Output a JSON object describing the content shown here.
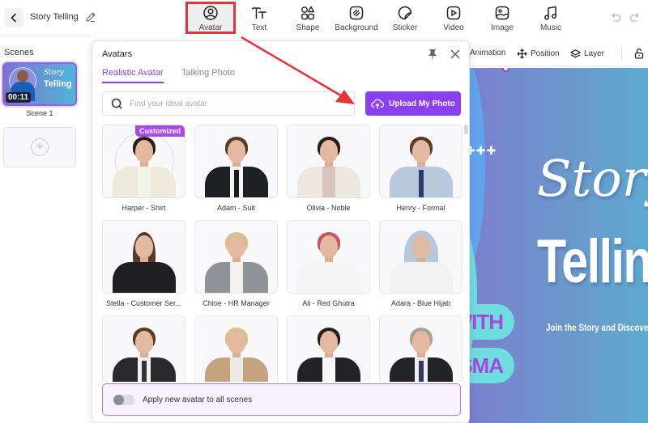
{
  "header": {
    "back_label": "Back",
    "project_title": "Story Telling",
    "tools": [
      {
        "id": "avatar",
        "label": "Avatar",
        "icon": "avatar-icon",
        "active": true
      },
      {
        "id": "text",
        "label": "Text",
        "icon": "text-icon",
        "active": false
      },
      {
        "id": "shape",
        "label": "Shape",
        "icon": "shape-icon",
        "active": false
      },
      {
        "id": "background",
        "label": "Background",
        "icon": "background-icon",
        "active": false
      },
      {
        "id": "sticker",
        "label": "Sticker",
        "icon": "sticker-icon",
        "active": false
      },
      {
        "id": "video",
        "label": "Video",
        "icon": "video-icon",
        "active": false
      },
      {
        "id": "image",
        "label": "Image",
        "icon": "image-icon",
        "active": false
      },
      {
        "id": "music",
        "label": "Music",
        "icon": "music-icon",
        "active": false
      }
    ],
    "highlight_color": "#e8333a"
  },
  "scenes": {
    "title": "Scenes",
    "items": [
      {
        "label": "Scene 1",
        "duration": "00:11",
        "thumb_title_1": "Story",
        "thumb_title_2": "Telling",
        "selected": true
      }
    ],
    "add_label": "+"
  },
  "canvas_toolbar": {
    "items": [
      {
        "label": "Animation",
        "icon": "animation-icon"
      },
      {
        "label": "Position",
        "icon": "move-icon"
      },
      {
        "label": "Layer",
        "icon": "layers-icon"
      }
    ],
    "lock_icon": "lock-open-icon"
  },
  "canvas": {
    "title_script": "Story",
    "title_bold": "Telling",
    "pill_1": "WITH",
    "pill_2": "SMA",
    "subtitle": "Join the Story and Discover",
    "dots": "✚✚✚"
  },
  "avatars_panel": {
    "title": "Avatars",
    "tabs": [
      {
        "label": "Realistic Avatar",
        "active": true
      },
      {
        "label": "Talking Photo",
        "active": false
      }
    ],
    "search_placeholder": "Find your ideal avatar",
    "search_value": "",
    "upload_label": "Upload My Photo",
    "accent_color": "#8a3ff0",
    "avatars": [
      {
        "name": "Harper - Shirt",
        "badge": "Customized",
        "outfit": "cream-shirt",
        "hair": "dark",
        "gender": "f"
      },
      {
        "name": "Adam - Suit",
        "badge": "",
        "outfit": "black-suit",
        "hair": "brown",
        "gender": "m"
      },
      {
        "name": "Olivia - Noble",
        "badge": "",
        "outfit": "cream-blazer",
        "hair": "dark",
        "gender": "f"
      },
      {
        "name": "Henry - Formal",
        "badge": "",
        "outfit": "blue-shirt",
        "hair": "brown",
        "gender": "m"
      },
      {
        "name": "Stella - Customer Ser...",
        "badge": "",
        "outfit": "black-shirt",
        "hair": "brown",
        "gender": "f"
      },
      {
        "name": "Chloe - HR Manager",
        "badge": "",
        "outfit": "grey-blazer",
        "hair": "blonde",
        "gender": "f"
      },
      {
        "name": "Ali - Red Ghutra",
        "badge": "",
        "outfit": "white-thobe",
        "hair": "ghutra",
        "gender": "m"
      },
      {
        "name": "Adara - Blue Hijab",
        "badge": "",
        "outfit": "blue-hijab",
        "hair": "hijab",
        "gender": "f"
      },
      {
        "name": "",
        "badge": "",
        "outfit": "vest",
        "hair": "brown",
        "gender": "m"
      },
      {
        "name": "",
        "badge": "",
        "outfit": "tan-blazer",
        "hair": "blonde",
        "gender": "f"
      },
      {
        "name": "",
        "badge": "",
        "outfit": "black-blazer",
        "hair": "dark",
        "gender": "f"
      },
      {
        "name": "",
        "badge": "",
        "outfit": "black-suit-old",
        "hair": "grey",
        "gender": "m"
      }
    ],
    "apply_all_label": "Apply new avatar to all scenes",
    "apply_all_enabled": false
  }
}
